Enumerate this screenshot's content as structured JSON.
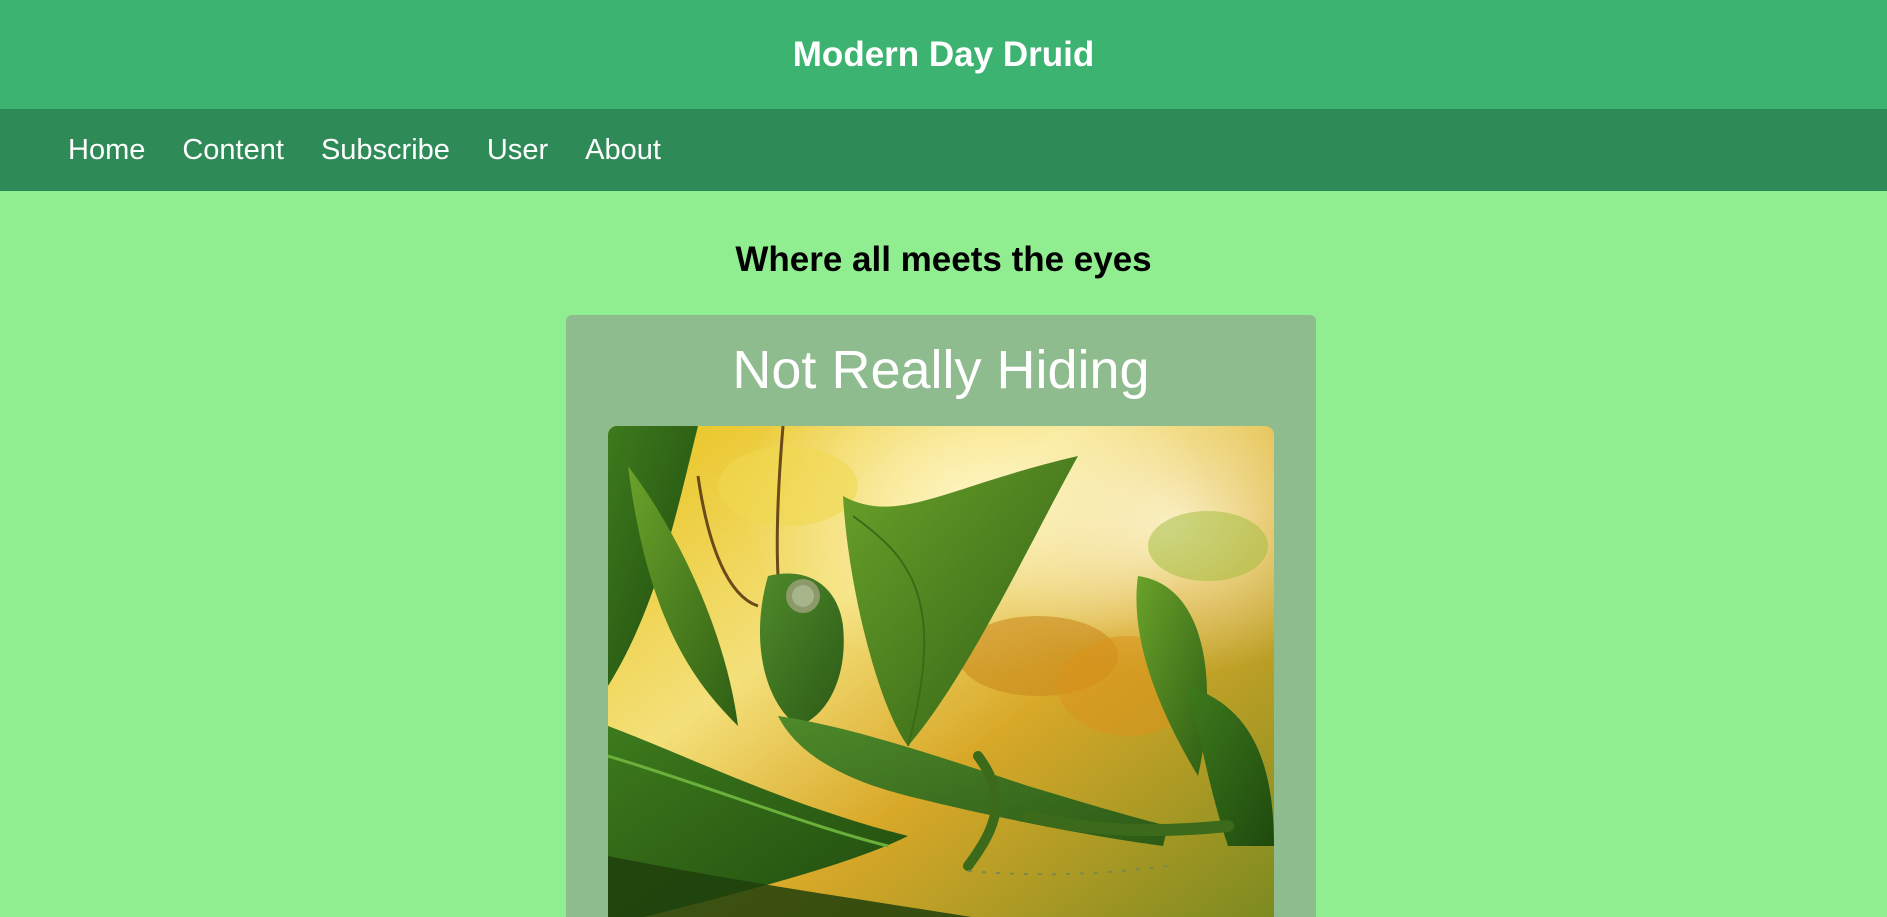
{
  "header": {
    "title": "Modern Day Druid"
  },
  "nav": {
    "items": [
      {
        "label": "Home"
      },
      {
        "label": "Content"
      },
      {
        "label": "Subscribe"
      },
      {
        "label": "User"
      },
      {
        "label": "About"
      }
    ]
  },
  "main": {
    "tagline": "Where all meets the eyes",
    "card": {
      "title": "Not Really Hiding",
      "image_subject": "grasshopper-on-leaves-photo"
    }
  },
  "colors": {
    "header_bg": "#3cb371",
    "nav_bg": "#2e8b57",
    "page_bg": "#90ee90",
    "card_bg": "#8fbc8f",
    "text_light": "#ffffff",
    "text_dark": "#000000"
  }
}
